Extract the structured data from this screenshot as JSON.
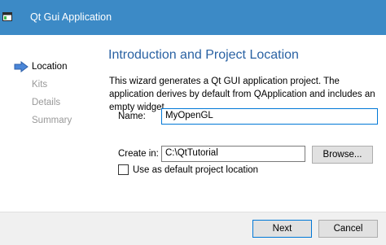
{
  "window": {
    "title": "Qt Gui Application"
  },
  "nav": {
    "items": [
      {
        "label": "Location"
      },
      {
        "label": "Kits"
      },
      {
        "label": "Details"
      },
      {
        "label": "Summary"
      }
    ]
  },
  "main": {
    "heading": "Introduction and Project Location",
    "description": "This wizard generates a Qt GUI application project. The application derives by default from QApplication and includes an empty widget.",
    "name_label": "Name:",
    "name_value": "MyOpenGL",
    "create_in_label": "Create in:",
    "create_in_value": "C:\\QtTutorial",
    "browse_label": "Browse...",
    "default_location_label": "Use as default project location",
    "default_location_checked": false
  },
  "footer": {
    "next_label": "Next",
    "cancel_label": "Cancel"
  },
  "colors": {
    "titlebar": "#3c8ac6",
    "heading": "#2a62a3",
    "nav_arrow": "#4a86d8",
    "focus_border": "#0078d7"
  }
}
